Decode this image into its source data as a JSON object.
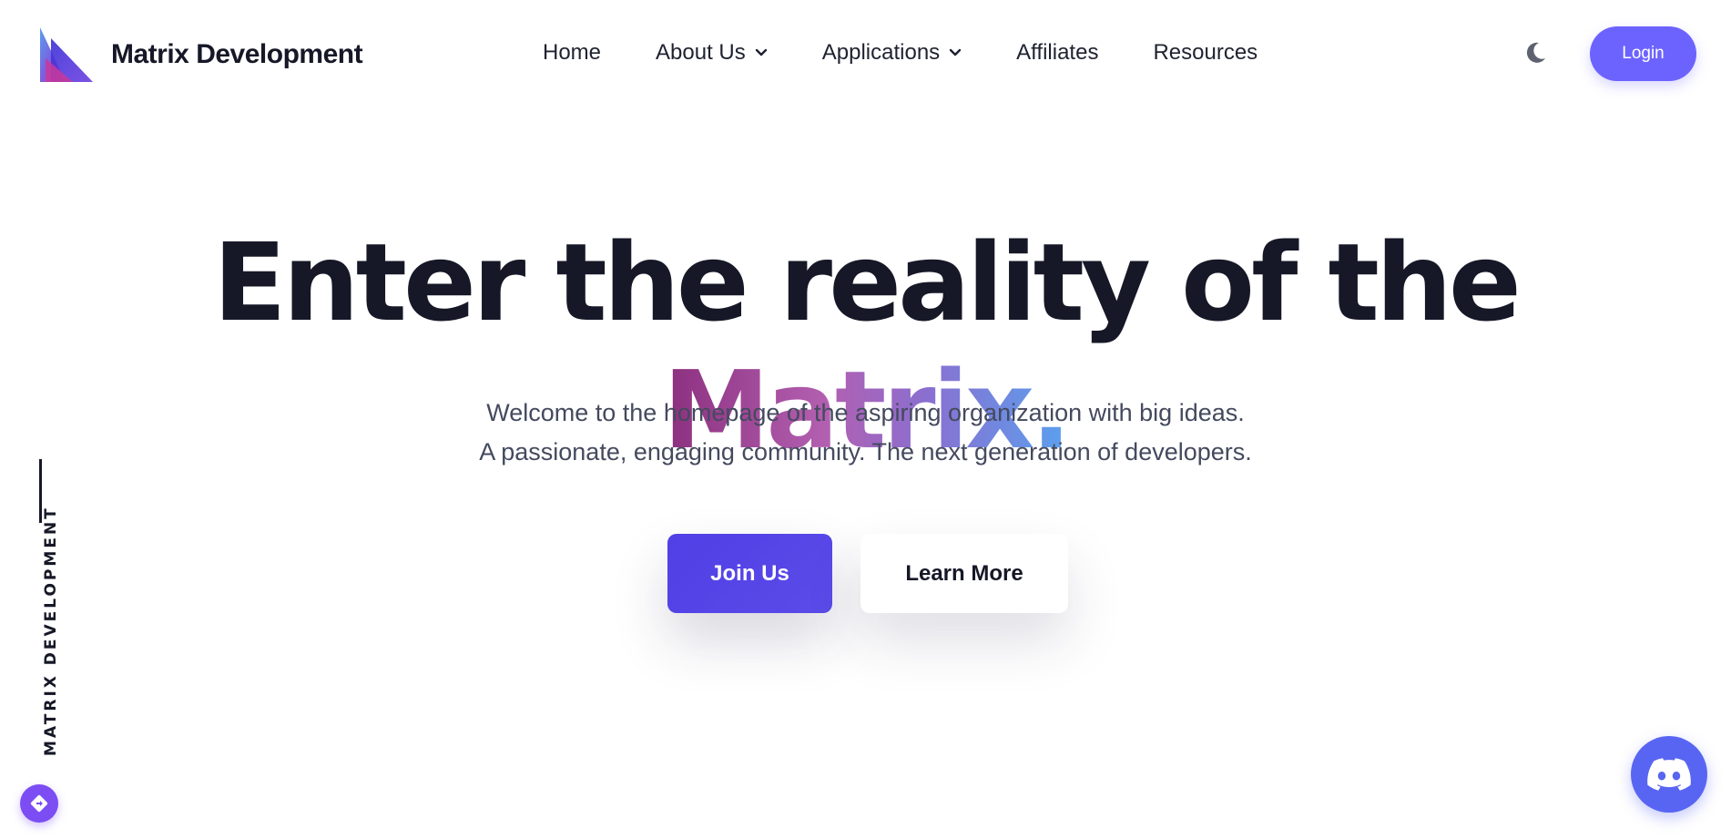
{
  "brand": {
    "name": "Matrix Development",
    "logo_icon": "matrix-logo-icon"
  },
  "nav": {
    "items": [
      {
        "label": "Home",
        "has_dropdown": false
      },
      {
        "label": "About Us",
        "has_dropdown": true
      },
      {
        "label": "Applications",
        "has_dropdown": true
      },
      {
        "label": "Affiliates",
        "has_dropdown": false
      },
      {
        "label": "Resources",
        "has_dropdown": false
      }
    ]
  },
  "header": {
    "theme_toggle_icon": "moon-icon",
    "login_label": "Login"
  },
  "hero": {
    "title_main": "Enter the reality of the ",
    "title_highlight": "Matrix.",
    "subtitle_line1": "Welcome to the homepage of the aspiring organization with big ideas.",
    "subtitle_line2": "A passionate, engaging community. The next generation of developers.",
    "primary_cta": "Join Us",
    "secondary_cta": "Learn More"
  },
  "side": {
    "vertical_text": "MATRIX DEVELOPMENT",
    "badge_icon": "diamond-arrow-icon"
  },
  "floating": {
    "discord_icon": "discord-icon"
  },
  "colors": {
    "accent": "#6c63ff",
    "primary_button": "#5040e6",
    "text_dark": "#161827",
    "text_muted": "#444a5e",
    "discord": "#5865f2",
    "gradient_start": "#8b2f7e",
    "gradient_end": "#5aa0ee"
  }
}
